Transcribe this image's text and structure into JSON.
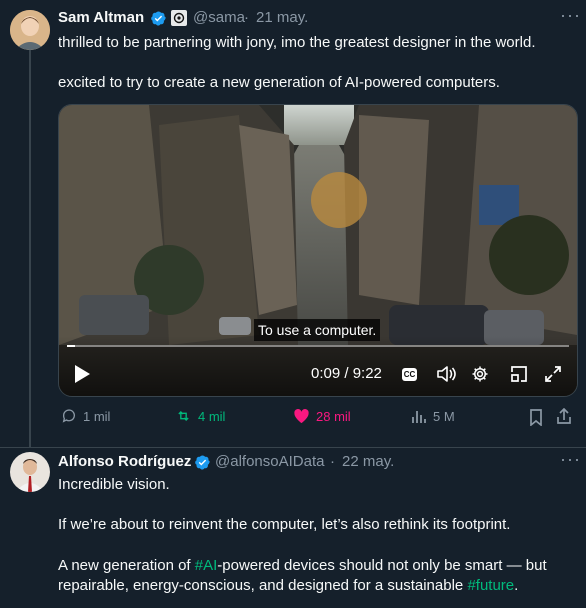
{
  "tweet1": {
    "display_name": "Sam Altman",
    "handle": "@sama",
    "date": "21 may.",
    "line1": "thrilled to be partnering with jony, imo the greatest designer in the world.",
    "line2": "excited to try to create a new generation of AI-powered computers.",
    "video": {
      "caption": "To use a computer.",
      "time": "0:09 / 9:22",
      "cc_label": "CC",
      "progress": 0.016
    },
    "actions": {
      "replies": "1 mil",
      "reposts": "4 mil",
      "likes": "28 mil",
      "views": "5 M"
    }
  },
  "tweet2": {
    "display_name": "Alfonso Rodríguez",
    "handle": "@alfonsoAIData",
    "date": "22 may.",
    "line1": "Incredible vision.",
    "line2": "If we’re about to reinvent the computer, let’s also rethink its footprint.",
    "line3_a": "A new generation of ",
    "line3_tag1": "#AI",
    "line3_b": "-powered devices should not only be smart — but",
    "line4_a": "repairable, energy-conscious, and designed for a sustainable ",
    "line4_tag2": "#future",
    "line4_b": "."
  },
  "icons": [
    "verified-badge-icon",
    "openai-logo-icon",
    "more-icon",
    "play-icon",
    "cc-icon",
    "volume-icon",
    "settings-icon",
    "pip-icon",
    "fullscreen-icon",
    "reply-icon",
    "repost-icon",
    "like-icon",
    "views-icon",
    "bookmark-icon",
    "share-icon"
  ],
  "colors": {
    "background": "#15202b",
    "verified": "#1d9bf0",
    "repost": "#00ba7c",
    "like": "#f91880",
    "muted": "#8b98a5",
    "hashtag": "#1d9bf0"
  }
}
